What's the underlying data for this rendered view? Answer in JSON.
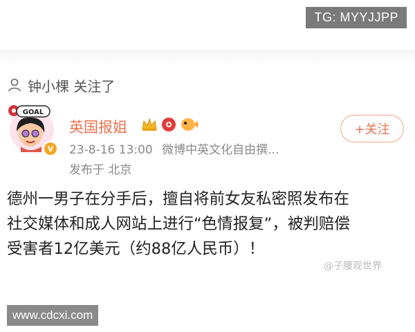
{
  "watermark_tg": "TG: MYYJJPP",
  "attention": {
    "text": "钟小棵 关注了"
  },
  "post": {
    "username": "英国报姐",
    "timestamp": "23-8-16 13:00",
    "source": "微博中英文化自由撰...",
    "location": "发布于 北京",
    "follow_label": "+关注",
    "avatar_text": "GOAL",
    "avatar_badge": "V",
    "text": "德州一男子在分手后，擅自将前女友私密照发布在\n社交媒体和成人网站上进行“色情报复”，被判赔偿\n受害者12亿美元（约88亿人民币）！"
  },
  "watermark_channel": "@子腰观世界",
  "watermark_site": "www.cdcxi.com",
  "colors": {
    "accent": "#eb7350",
    "meta_text": "#888888",
    "body_text": "#222222"
  }
}
